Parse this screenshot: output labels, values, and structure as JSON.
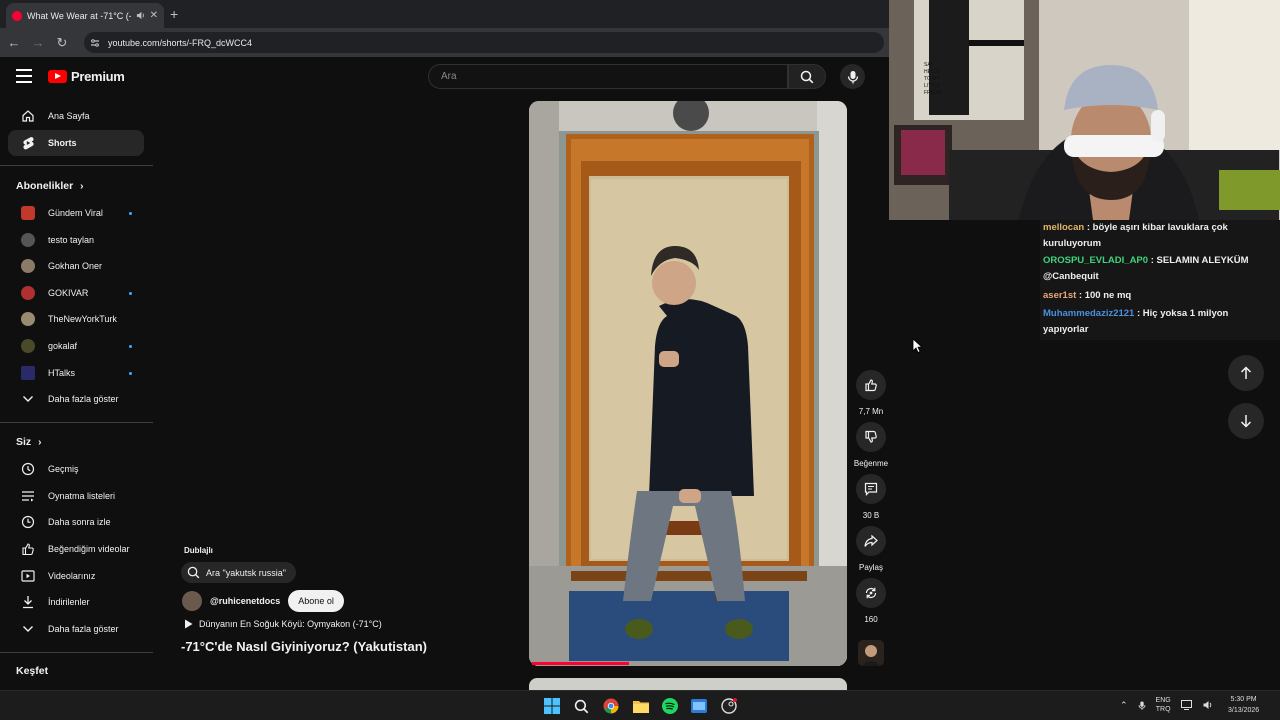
{
  "browser": {
    "tab_title": "What We Wear at -71°C (-5",
    "new_tab": "+",
    "url": "youtube.com/shorts/-FRQ_dcWCC4"
  },
  "header": {
    "logo_text": "Premium",
    "search_placeholder": "Ara"
  },
  "sidebar": {
    "main": [
      {
        "label": "Ana Sayfa",
        "icon": "home-icon"
      },
      {
        "label": "Shorts",
        "icon": "shorts-icon",
        "active": true
      }
    ],
    "subscriptions_heading": "Abonelikler",
    "subscriptions": [
      {
        "label": "Gündem Viral",
        "color": "#c0392b",
        "dot": true
      },
      {
        "label": "testo taylan",
        "color": "#555555",
        "dot": false
      },
      {
        "label": "Gokhan Oner",
        "color": "#8a7a66",
        "dot": false
      },
      {
        "label": "GOKIVAR",
        "color": "#b03030",
        "dot": true
      },
      {
        "label": "TheNewYorkTurk",
        "color": "#9a8a70",
        "dot": false
      },
      {
        "label": "gokalaf",
        "color": "#4a4a2a",
        "dot": true
      },
      {
        "label": "HTalks",
        "color": "#2a2a6a",
        "dot": true
      }
    ],
    "show_more_subs": "Daha fazla göster",
    "you_heading": "Siz",
    "you_items": [
      {
        "label": "Geçmiş",
        "icon": "history-icon"
      },
      {
        "label": "Oynatma listeleri",
        "icon": "playlist-icon"
      },
      {
        "label": "Daha sonra izle",
        "icon": "watch-later-icon"
      },
      {
        "label": "Beğendiğim videolar",
        "icon": "liked-icon"
      },
      {
        "label": "Videolarınız",
        "icon": "your-videos-icon"
      },
      {
        "label": "İndirilenler",
        "icon": "download-icon"
      }
    ],
    "show_more_you": "Daha fazla göster",
    "explore_heading": "Keşfet"
  },
  "video": {
    "dubbed_label": "Dublajlı",
    "search_pill": "Ara \"yakutsk russia\"",
    "channel": "@ruhicenetdocs",
    "subscribe": "Abone ol",
    "music": "Dünyanın En Soğuk Köyü: Oymyakon (-71°C)",
    "title": "-71°C'de Nasıl Giyiniyoruz? (Yakutistan)",
    "progress": 0.31
  },
  "actions": {
    "likes": "7,7 Mn",
    "dislike": "Beğenme",
    "comments": "30 B",
    "share": "Paylaş",
    "remix": "160"
  },
  "chat": [
    {
      "user": "mellocan",
      "color": "#e2b46a",
      "text": "böyle aşırı kibar lavuklara çok kuruluyorum"
    },
    {
      "user": "OROSPU_EVLADI_AP0",
      "color": "#3fd47a",
      "text": "SELAMIN ALEYKÜM @Canbequit"
    },
    {
      "user": "aser1st",
      "color": "#e8a878",
      "text": "100 ne mq"
    },
    {
      "user": "Muhammedaziz2121",
      "color": "#4b8fe0",
      "text": "Hiç yoksa 1 milyon yapıyorlar"
    }
  ],
  "webcam_poster_text": [
    "SAY",
    "HELLO",
    "TO MY",
    "LITTLE",
    "FRIEND"
  ],
  "tray": {
    "lang_top": "ENG",
    "lang_bottom": "TRQ",
    "time": "5:30 PM",
    "date": "3/13/2026"
  }
}
